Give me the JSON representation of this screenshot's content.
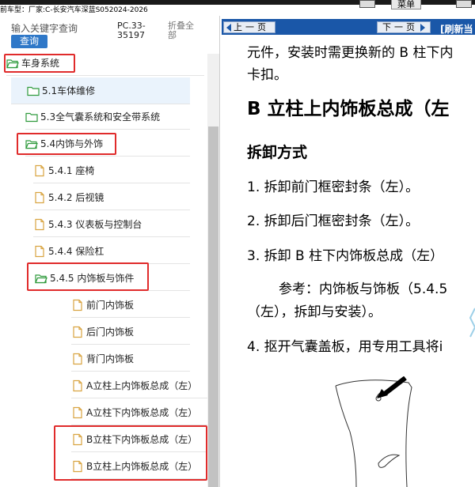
{
  "topbar": {
    "menu_label": "菜单"
  },
  "vehicle_line": "前车型：厂家:C-长安汽车深蓝S052024-2026",
  "left": {
    "search_label": "输入关键字查询",
    "query_button": "查询",
    "pc_code": "PC.33-35197",
    "collapse_all": "折叠全部",
    "tree": [
      {
        "label": "车身系统",
        "icon": "folder-open-icon"
      },
      {
        "label": "5.1车体维修",
        "icon": "folder-icon"
      },
      {
        "label": "5.3全气囊系统和安全带系统",
        "icon": "folder-icon"
      },
      {
        "label": "5.4内饰与外饰",
        "icon": "folder-open-icon"
      },
      {
        "label": "5.4.1 座椅",
        "icon": "document-icon"
      },
      {
        "label": "5.4.2 后视镜",
        "icon": "document-icon"
      },
      {
        "label": "5.4.3 仪表板与控制台",
        "icon": "document-icon"
      },
      {
        "label": "5.4.4 保险杠",
        "icon": "document-icon"
      },
      {
        "label": "5.4.5 内饰板与饰件",
        "icon": "folder-open-icon"
      },
      {
        "label": "前门内饰板",
        "icon": "document-icon"
      },
      {
        "label": "后门内饰板",
        "icon": "document-icon"
      },
      {
        "label": "背门内饰板",
        "icon": "document-icon"
      },
      {
        "label": "A立柱上内饰板总成（左）",
        "icon": "document-icon"
      },
      {
        "label": "A立柱下内饰板总成（左）",
        "icon": "document-icon"
      },
      {
        "label": "B立柱下内饰板总成（左）",
        "icon": "document-icon"
      },
      {
        "label": "B立柱上内饰板总成（左）",
        "icon": "document-icon"
      }
    ]
  },
  "nav": {
    "prev_label": "上一页",
    "next_label": "下一页",
    "refresh_label": "[刷新当"
  },
  "doc": {
    "line1": "元件，安装时需更换新的 B 柱下内",
    "line2": "卡扣。",
    "section_title": "B 立柱上内饰板总成（左",
    "subtitle": "拆卸方式",
    "step1": "1.   拆卸前门框密封条（左）。",
    "step2": "2.  拆卸后门框密封条（左）。",
    "step3": "3.   拆卸 B 柱下内饰板总成（左）",
    "ref1": "参考：内饰板与饰板（5.4.5",
    "ref2": "（左），拆卸与安装）。",
    "step4": "4. 抠开气囊盖板，用专用工具将i"
  },
  "colors": {
    "nav_bar": "#1a57a8",
    "query_button": "#2f78c8",
    "highlight": "#e02b2b",
    "folder": "#2f9a3c",
    "document": "#d9a441"
  }
}
